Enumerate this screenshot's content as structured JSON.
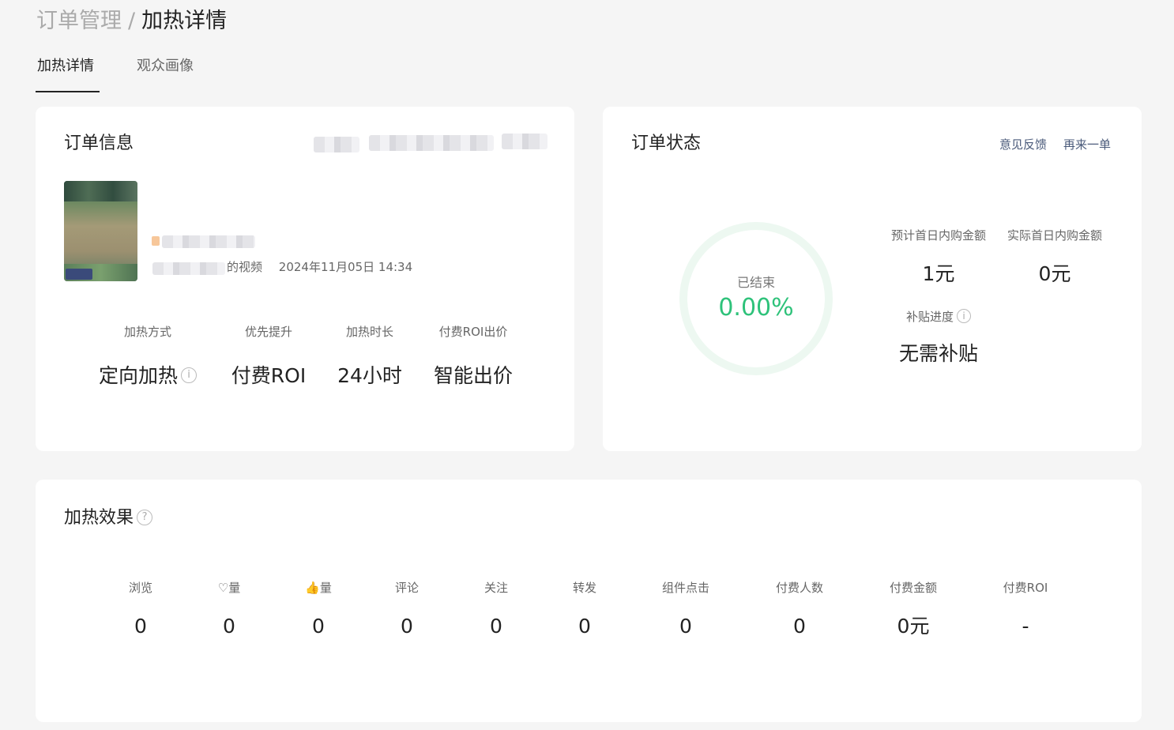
{
  "breadcrumb": {
    "parent": "订单管理",
    "separator": "/",
    "current": "加热详情"
  },
  "tabs": [
    {
      "label": "加热详情",
      "active": true
    },
    {
      "label": "观众画像",
      "active": false
    }
  ],
  "order_info": {
    "title": "订单信息",
    "video_suffix": "的视频",
    "video_time": "2024年11月05日 14:34",
    "stats": [
      {
        "label": "加热方式",
        "value": "定向加热",
        "has_info": true
      },
      {
        "label": "优先提升",
        "value": "付费ROI"
      },
      {
        "label": "加热时长",
        "value": "24小时"
      },
      {
        "label": "付费ROI出价",
        "value": "智能出价"
      }
    ]
  },
  "order_status": {
    "title": "订单状态",
    "feedback_link": "意见反馈",
    "reorder_link": "再来一单",
    "progress_label": "已结束",
    "progress_value": "0.00%",
    "estimated_label": "预计首日内购金额",
    "estimated_value": "1元",
    "actual_label": "实际首日内购金额",
    "actual_value": "0元",
    "subsidy_label": "补贴进度",
    "subsidy_value": "无需补贴"
  },
  "effect": {
    "title": "加热效果",
    "metrics": [
      {
        "label": "浏览",
        "value": "0"
      },
      {
        "label": "♡量",
        "value": "0"
      },
      {
        "label": "👍量",
        "value": "0"
      },
      {
        "label": "评论",
        "value": "0"
      },
      {
        "label": "关注",
        "value": "0"
      },
      {
        "label": "转发",
        "value": "0"
      },
      {
        "label": "组件点击",
        "value": "0"
      },
      {
        "label": "付费人数",
        "value": "0"
      },
      {
        "label": "付费金额",
        "value": "0元"
      },
      {
        "label": "付费ROI",
        "value": "-"
      }
    ]
  },
  "icons": {
    "info": "i",
    "help": "?"
  },
  "colors": {
    "accent_green": "#2ec27a",
    "link": "#4a5a7a",
    "ring_track": "#edf8f1"
  }
}
